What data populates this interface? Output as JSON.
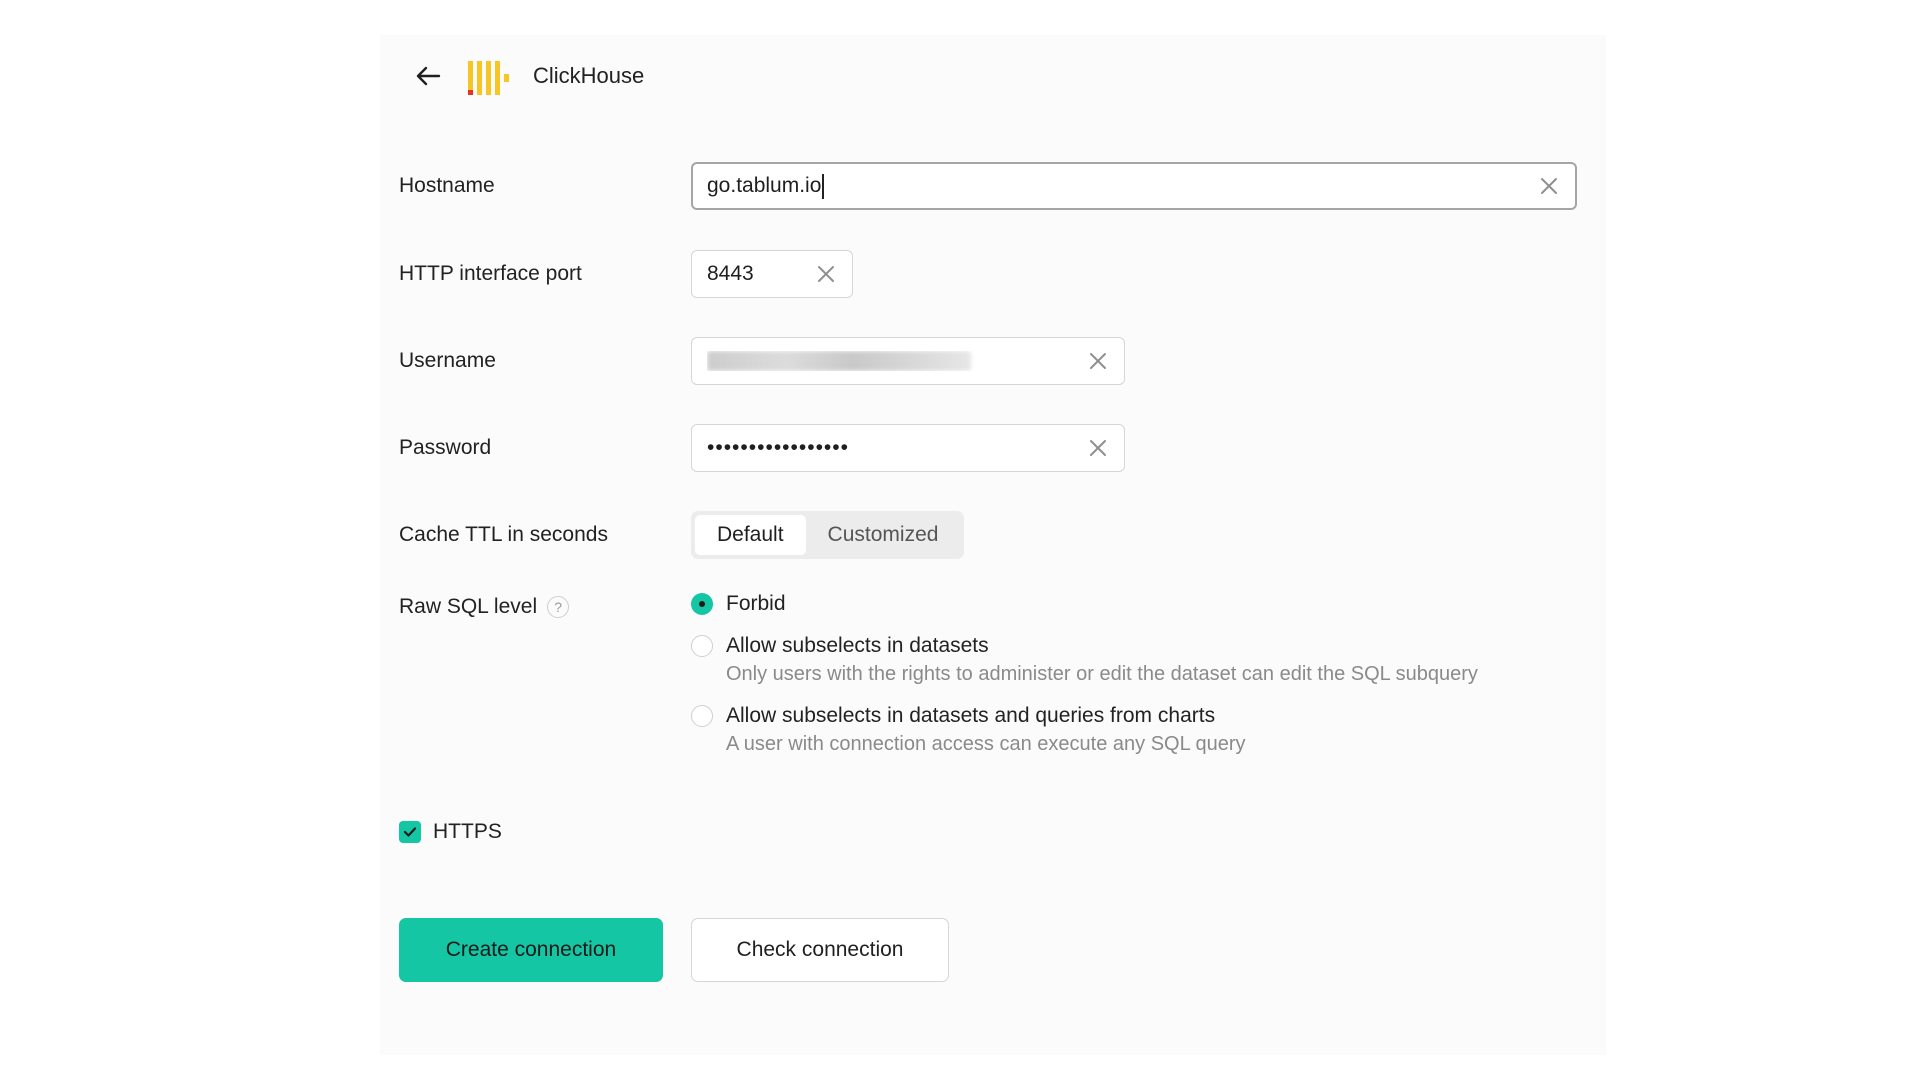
{
  "header": {
    "brand": "ClickHouse",
    "back_icon": "arrow-left-icon",
    "logo_icon": "clickhouse-logo-icon",
    "logo_colors": [
      "#f7c625",
      "#e8321f"
    ]
  },
  "form": {
    "hostname": {
      "label": "Hostname",
      "value": "go.tablum.io"
    },
    "port": {
      "label": "HTTP interface port",
      "value": "8443"
    },
    "username": {
      "label": "Username"
    },
    "password": {
      "label": "Password",
      "value": "•••••••••••••••••"
    },
    "cache_ttl": {
      "label": "Cache TTL in seconds",
      "options": [
        "Default",
        "Customized"
      ],
      "selected": "Default"
    },
    "raw_sql": {
      "label": "Raw SQL level",
      "help": "?",
      "options": [
        {
          "title": "Forbid",
          "description": "",
          "checked": true
        },
        {
          "title": "Allow subselects in datasets",
          "description": "Only users with the rights to administer or edit the dataset can edit the SQL subquery",
          "checked": false
        },
        {
          "title": "Allow subselects in datasets and queries from charts",
          "description": "A user with connection access can execute any SQL query",
          "checked": false
        }
      ]
    },
    "https": {
      "label": "HTTPS",
      "checked": true
    }
  },
  "actions": {
    "create": "Create connection",
    "check": "Check connection"
  },
  "colors": {
    "accent": "#14c6a3",
    "background": "#fbfbfb"
  }
}
